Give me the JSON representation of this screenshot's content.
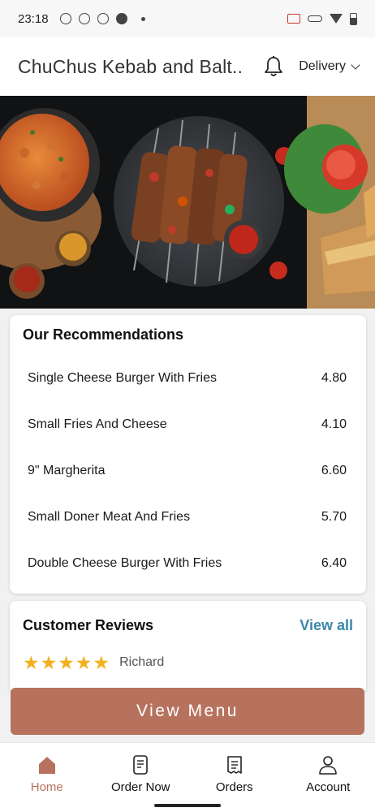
{
  "status_bar": {
    "time": "23:18"
  },
  "header": {
    "title": "ChuChus Kebab and Balt..",
    "mode": "Delivery"
  },
  "recommendations": {
    "title": "Our Recommendations",
    "items": [
      {
        "name": "Single Cheese Burger With Fries",
        "price": "4.80"
      },
      {
        "name": "Small Fries And Cheese",
        "price": "4.10"
      },
      {
        "name": "9\" Margherita",
        "price": "6.60"
      },
      {
        "name": "Small Doner Meat And Fries",
        "price": "5.70"
      },
      {
        "name": "Double Cheese Burger With Fries",
        "price": "6.40"
      }
    ]
  },
  "reviews": {
    "title": "Customer Reviews",
    "view_all": "View all",
    "first": {
      "stars": 5,
      "reviewer": "Richard"
    }
  },
  "view_menu_label": "View Menu",
  "nav": {
    "items": [
      {
        "label": "Home",
        "icon": "home-icon",
        "active": true
      },
      {
        "label": "Order Now",
        "icon": "menu-book-icon",
        "active": false
      },
      {
        "label": "Orders",
        "icon": "receipt-icon",
        "active": false
      },
      {
        "label": "Account",
        "icon": "person-icon",
        "active": false
      }
    ]
  },
  "colors": {
    "accent": "#b7725e",
    "link": "#3b88a8",
    "star": "#f2b01e"
  }
}
